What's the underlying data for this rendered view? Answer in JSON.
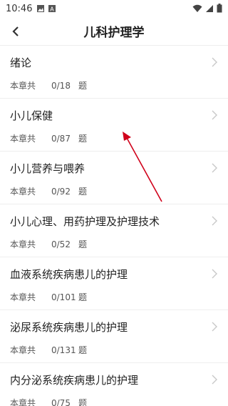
{
  "status": {
    "time": "10:46"
  },
  "header": {
    "title": "儿科护理学"
  },
  "chapters": [
    {
      "title": "绪论",
      "prefix": "本章共",
      "count": "0/18",
      "suffix": "题"
    },
    {
      "title": "小儿保健",
      "prefix": "本章共",
      "count": "0/87",
      "suffix": "题"
    },
    {
      "title": "小儿营养与喂养",
      "prefix": "本章共",
      "count": "0/92",
      "suffix": "题"
    },
    {
      "title": "小儿心理、用药护理及护理技术",
      "prefix": "本章共",
      "count": "0/52",
      "suffix": "题"
    },
    {
      "title": "血液系统疾病患儿的护理",
      "prefix": "本章共",
      "count": "0/101",
      "suffix": "题"
    },
    {
      "title": "泌尿系统疾病患儿的护理",
      "prefix": "本章共",
      "count": "0/131",
      "suffix": "题"
    },
    {
      "title": "内分泌系统疾病患儿的护理",
      "prefix": "本章共",
      "count": "0/75",
      "suffix": "题"
    }
  ],
  "colors": {
    "annotation_arrow": "#d0021b",
    "divider": "#eeeeee",
    "chevron": "#c8c8c8"
  }
}
